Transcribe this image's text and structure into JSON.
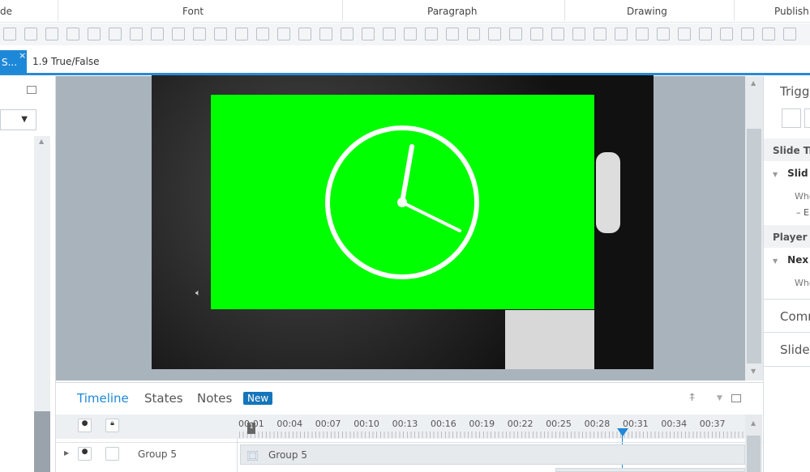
{
  "ribbon": {
    "groups": [
      "de",
      "Font",
      "Paragraph",
      "Drawing",
      "Publish"
    ]
  },
  "tabs": {
    "active": "S...",
    "second": "1.9 True/False"
  },
  "right_panel": {
    "title": "Trigge",
    "slide_triggers": "Slide Tr",
    "slide_item": "Slid",
    "when1": "Whe",
    "e1": "– E",
    "player_triggers": "Player T",
    "next_item": "Nex",
    "when2": "Whe",
    "comments": "Comm",
    "slide": "Slide"
  },
  "timeline": {
    "tabs": [
      "Timeline",
      "States",
      "Notes"
    ],
    "new_badge": "New",
    "ticks": [
      "00:01",
      "00:04",
      "00:07",
      "00:10",
      "00:13",
      "00:16",
      "00:19",
      "00:22",
      "00:25",
      "00:28",
      "00:31",
      "00:34",
      "00:37"
    ],
    "row_name": "Group 5",
    "bar_label": "Group 5",
    "marker": "1",
    "accent": "#1e88d8"
  }
}
